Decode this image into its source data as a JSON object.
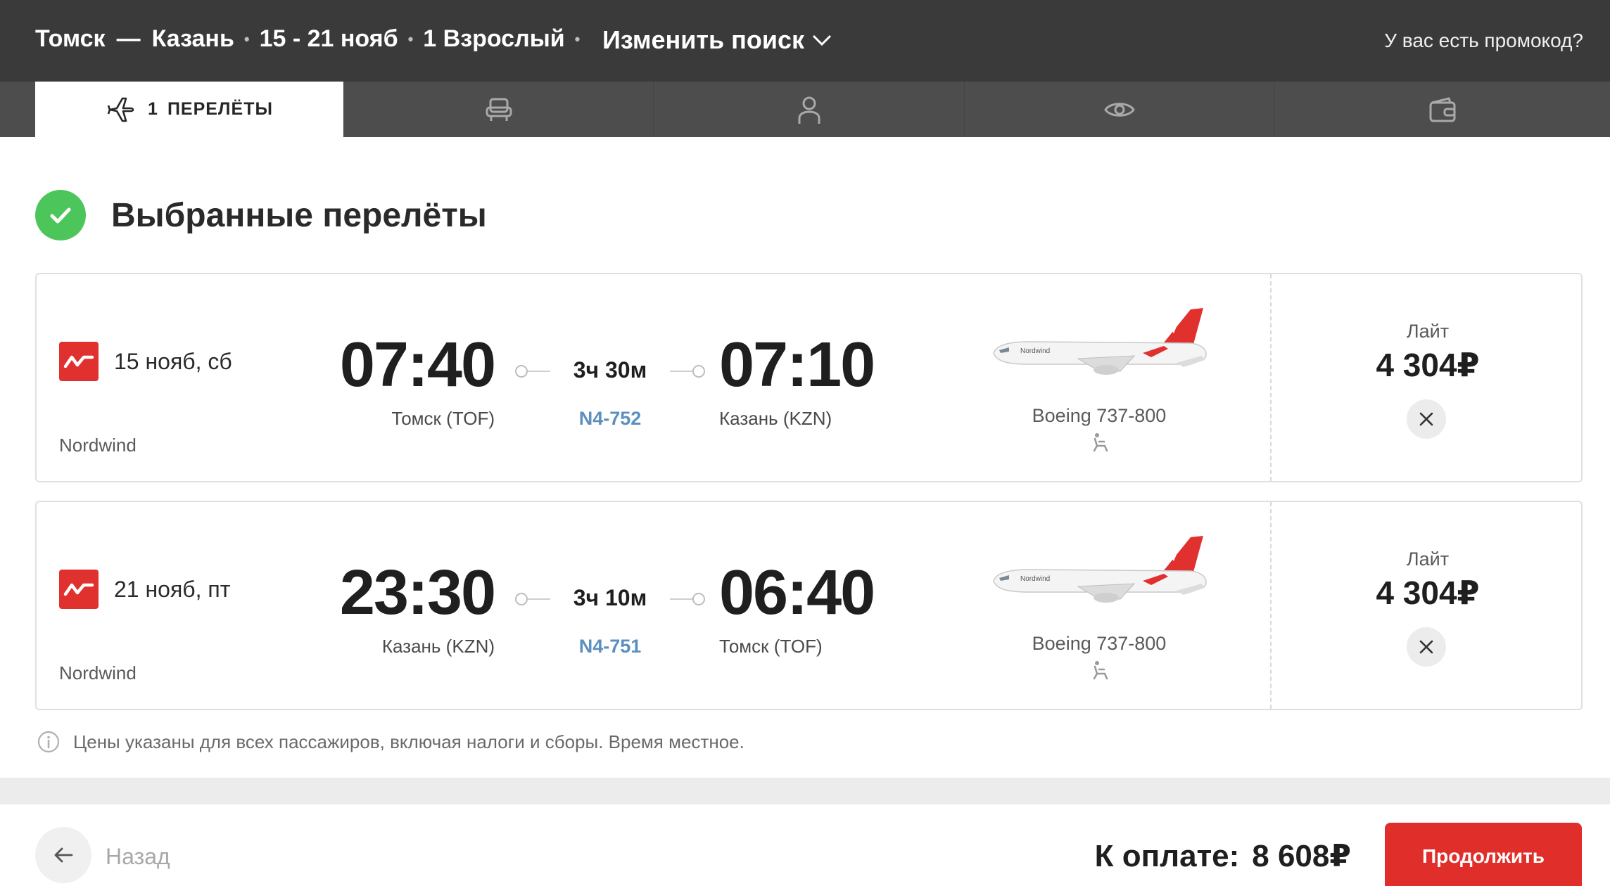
{
  "header": {
    "origin": "Томск",
    "separator": "—",
    "destination": "Казань",
    "dates": "15 - 21 нояб",
    "passengers": "1 Взрослый",
    "change_search": "Изменить поиск",
    "promo": "У вас есть промокод?"
  },
  "tabs": [
    {
      "number": "1",
      "label": "ПЕРЕЛЁТЫ",
      "icon": "plane-icon",
      "active": true
    },
    {
      "label": "",
      "icon": "seat-icon",
      "active": false
    },
    {
      "label": "",
      "icon": "person-icon",
      "active": false
    },
    {
      "label": "",
      "icon": "eye-icon",
      "active": false
    },
    {
      "label": "",
      "icon": "wallet-icon",
      "active": false
    }
  ],
  "section": {
    "title": "Выбранные перелёты"
  },
  "flights": [
    {
      "date": "15 нояб, сб",
      "airline": "Nordwind",
      "departure_time": "07:40",
      "arrival_time": "07:10",
      "departure_place": "Томск (TOF)",
      "arrival_place": "Казань (KZN)",
      "duration": "3ч 30м",
      "flight_number": "N4-752",
      "aircraft": "Boeing 737-800",
      "fare": "Лайт",
      "price": "4 304₽"
    },
    {
      "date": "21 нояб, пт",
      "airline": "Nordwind",
      "departure_time": "23:30",
      "arrival_time": "06:40",
      "departure_place": "Казань (KZN)",
      "arrival_place": "Томск (TOF)",
      "duration": "3ч 10м",
      "flight_number": "N4-751",
      "aircraft": "Boeing 737-800",
      "fare": "Лайт",
      "price": "4 304₽"
    }
  ],
  "info_note": "Цены указаны для всех пассажиров, включая налоги и сборы. Время местное.",
  "footer": {
    "back": "Назад",
    "total_label": "К оплате:",
    "total_amount": "8 608₽",
    "continue": "Продолжить"
  },
  "colors": {
    "header_bg": "#3a3a3a",
    "accent_red": "#e02e2a",
    "success_green": "#4cc65a",
    "link_blue": "#5b8fc0"
  }
}
